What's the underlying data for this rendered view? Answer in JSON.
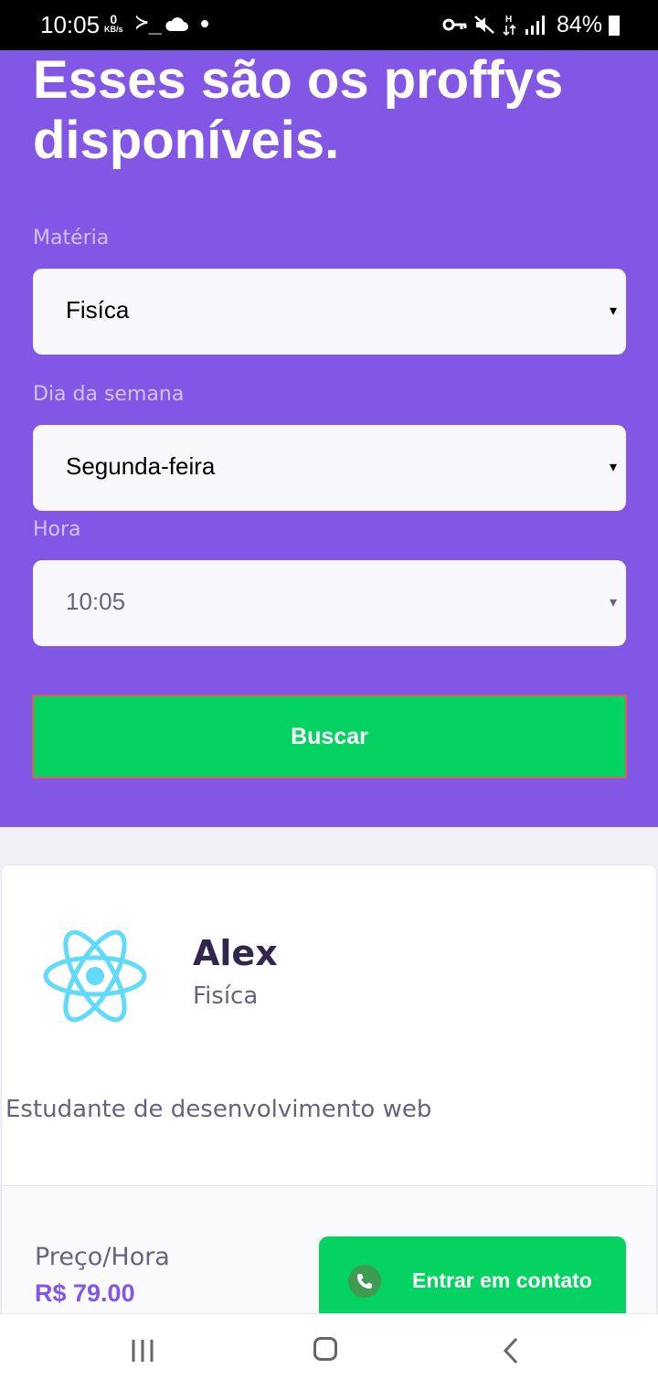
{
  "status_bar": {
    "time": "10:05",
    "net_speed_value": "0",
    "net_speed_unit": "KB/s",
    "terminal_glyph": "≻_",
    "battery_percent": "84%"
  },
  "page": {
    "title": "Esses são os proffys disponíveis."
  },
  "filters": {
    "subject_label": "Matéria",
    "subject_value": "Fisíca",
    "weekday_label": "Dia da semana",
    "weekday_value": "Segunda-feira",
    "time_label": "Hora",
    "time_value": "10:05",
    "caret": "▾",
    "search_button": "Buscar"
  },
  "teacher_card": {
    "name": "Alex",
    "subject": "Fisíca",
    "bio": "Estudante de desenvolvimento web",
    "price_label": "Preço/Hora",
    "price_value": "R$ 79.00",
    "contact_button": "Entrar em contato"
  },
  "colors": {
    "primary": "#8257e5",
    "secondary": "#04d361",
    "title_dark": "#32264d",
    "text_muted": "#6a6180"
  }
}
